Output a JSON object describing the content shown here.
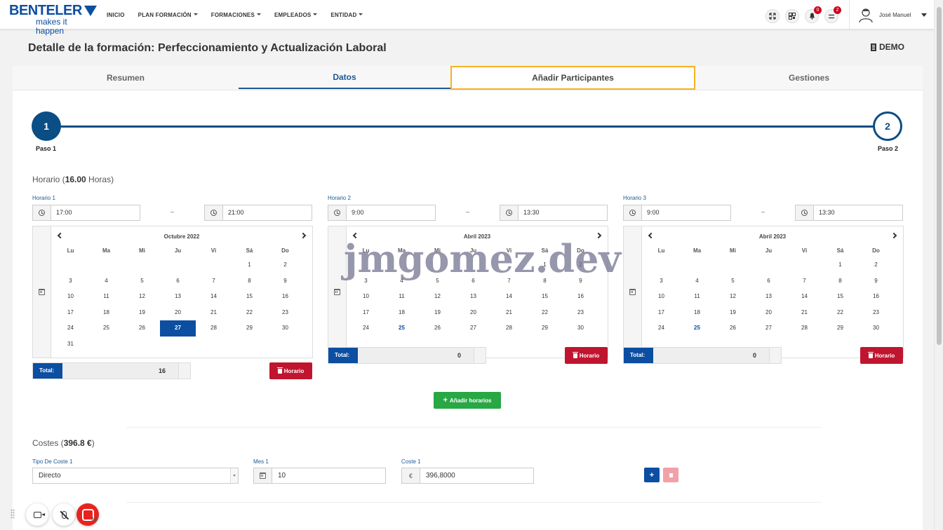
{
  "brand": {
    "name": "BENTELER",
    "tagline": "makes it happen"
  },
  "nav": [
    "INICIO",
    "PLAN FORMACIÓN",
    "FORMACIONES",
    "EMPLEADOS",
    "ENTIDAD"
  ],
  "header_badges": {
    "notifications": "0",
    "messages": "2"
  },
  "user": {
    "name": "José Manuel"
  },
  "page": {
    "title": "Detalle de la formación: Perfeccionamiento y Actualización Laboral",
    "entity": "DEMO"
  },
  "tabs": [
    "Resumen",
    "Datos",
    "Añadir Participantes",
    "Gestiones"
  ],
  "steps": [
    {
      "number": "1",
      "label": "Paso 1"
    },
    {
      "number": "2",
      "label": "Paso 2"
    }
  ],
  "horario": {
    "title_prefix": "Horario (",
    "hours": "16.00",
    "title_suffix": " Horas)",
    "dash": "–",
    "schedules": [
      {
        "label": "Horario 1",
        "start": "17:00",
        "end": "21:00",
        "month": "Octubre 2022",
        "total": "16"
      },
      {
        "label": "Horario 2",
        "start": "9:00",
        "end": "13:30",
        "month": "Abril 2023",
        "total": "0"
      },
      {
        "label": "Horario 3",
        "start": "9:00",
        "end": "13:30",
        "month": "Abril 2023",
        "total": "0"
      }
    ],
    "weekdays": [
      "Lu",
      "Ma",
      "Mi",
      "Ju",
      "Vi",
      "Sá",
      "Do"
    ],
    "total_label": "Total:",
    "delete_label": "Horario",
    "add_label": "Añadir horarios"
  },
  "costes": {
    "title_prefix": "Costes (",
    "amount": "396.8 €",
    "title_suffix": ")",
    "tipo_label": "Tipo De Coste 1",
    "tipo_value": "Directo",
    "mes_label": "Mes 1",
    "mes_value": "10",
    "coste_label": "Coste 1",
    "coste_value": "396,8000",
    "currency": "€",
    "add_symbol": "+"
  },
  "watermark": "jmgomez.dev",
  "partial_text": "M"
}
